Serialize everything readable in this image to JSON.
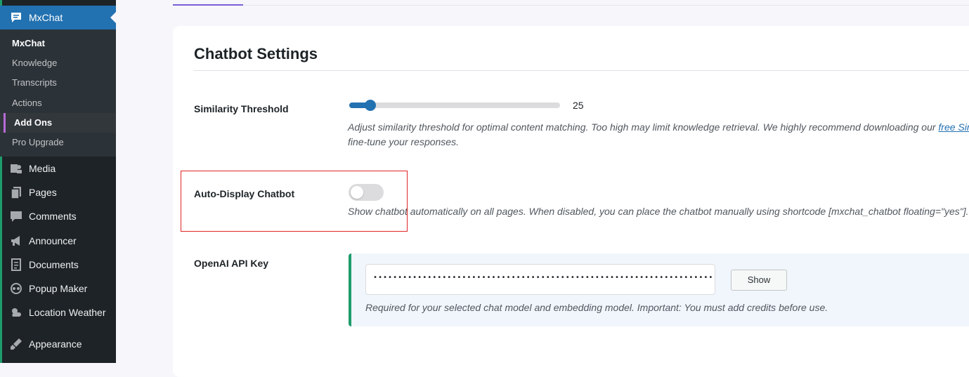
{
  "sidebar": {
    "plugin": {
      "label": "MxChat",
      "icon": "chat-icon"
    },
    "submenu": [
      "MxChat",
      "Knowledge",
      "Transcripts",
      "Actions",
      "Add Ons",
      "Pro Upgrade"
    ],
    "items": [
      {
        "label": "Media",
        "icon": "media-icon"
      },
      {
        "label": "Pages",
        "icon": "pages-icon"
      },
      {
        "label": "Comments",
        "icon": "comments-icon"
      },
      {
        "label": "Announcer",
        "icon": "announcer-icon"
      },
      {
        "label": "Documents",
        "icon": "documents-icon"
      },
      {
        "label": "Popup Maker",
        "icon": "popup-maker-icon"
      },
      {
        "label": "Location Weather",
        "icon": "weather-icon"
      },
      {
        "label": "Appearance",
        "icon": "appearance-icon"
      }
    ]
  },
  "settings": {
    "title": "Chatbot Settings",
    "similarity": {
      "label": "Similarity Threshold",
      "value": "25",
      "fill_fraction": 0.1,
      "desc_line1_pre": "Adjust similarity threshold for optimal content matching. Too high may limit knowledge retrieval. We highly recommend downloading our ",
      "desc_link": "free Sim",
      "desc_line2": "fine-tune your responses."
    },
    "auto_display": {
      "label": "Auto-Display Chatbot",
      "enabled": false,
      "desc": "Show chatbot automatically on all pages. When disabled, you can place the chatbot manually using shortcode [mxchat_chatbot floating=\"yes\"]."
    },
    "api_key": {
      "label": "OpenAI API Key",
      "masked_value": "••••••••••••••••••••••••••••••••••••••••••••••••••••••••••••••••••••••••••••••••••••••••••",
      "show_label": "Show",
      "desc": "Required for your selected chat model and embedding model. Important: You must add credits before use."
    }
  },
  "colors": {
    "accent": "#2271b1",
    "sidebar_bg": "#1d2327",
    "submenu_bg": "#2c3338",
    "success": "#1e9c6b",
    "highlight": "#e02424"
  }
}
